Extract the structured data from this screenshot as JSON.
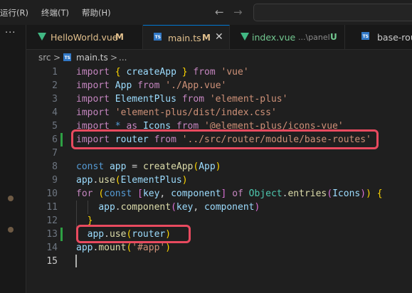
{
  "menubar": {
    "items": [
      "运行(R)",
      "终端(T)",
      "帮助(H)"
    ],
    "back_arrow": "←",
    "forward_arrow": "→"
  },
  "left_strip": {
    "more_icon": "···"
  },
  "tabs": [
    {
      "label": "HelloWorld.vue",
      "status": "M",
      "icon": "vue-icon",
      "active": false
    },
    {
      "label": "main.ts",
      "status": "M",
      "icon": "ts-icon",
      "active": true,
      "close": "✕"
    },
    {
      "label": "index.vue",
      "hint": "...\\panel",
      "status": "U",
      "icon": "vue-icon",
      "active": false
    },
    {
      "label": "base-rou",
      "icon": "ts-icon",
      "active": false
    }
  ],
  "breadcrumb": {
    "folder": "src",
    "sep": ">",
    "file": "main.ts",
    "ellipsis": "..."
  },
  "editor": {
    "line_numbers": [
      "1",
      "2",
      "3",
      "4",
      "5",
      "6",
      "7",
      "8",
      "9",
      "10",
      "11",
      "12",
      "13",
      "14",
      "15"
    ],
    "active_line": "15",
    "lines": [
      "import { createApp } from 'vue'",
      "import App from './App.vue'",
      "import ElementPlus from 'element-plus'",
      "import 'element-plus/dist/index.css'",
      "import * as Icons from '@element-plus/icons-vue'",
      "import router from '../src/router/module/base-routes'",
      "",
      "const app = createApp(App)",
      "app.use(ElementPlus)",
      "for (const [key, component] of Object.entries(Icons)) {",
      "    app.component(key, component)",
      "  }",
      "  app.use(router)",
      "app.mount('#app')",
      ""
    ]
  },
  "colors": {
    "keyword": "#c586c0",
    "string": "#ce9178",
    "variable": "#9cdcfe",
    "function": "#dcdcaa",
    "class": "#4ec9b0",
    "storage": "#569cd6",
    "highlight_box": "#e84a5f",
    "modified_gutter": "#2ea043",
    "vue_green": "#41b883",
    "modified_tab": "#e2c08d",
    "untracked_tab": "#73c991"
  }
}
